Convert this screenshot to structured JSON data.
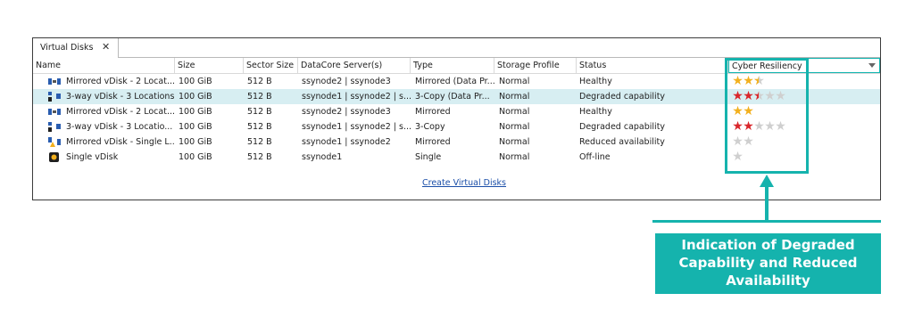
{
  "tab": {
    "label": "Virtual Disks",
    "close_glyph": "✕"
  },
  "columns": [
    {
      "key": "name",
      "label": "Name"
    },
    {
      "key": "size",
      "label": "Size"
    },
    {
      "key": "sector",
      "label": "Sector Size"
    },
    {
      "key": "servers",
      "label": "DataCore Server(s)"
    },
    {
      "key": "type",
      "label": "Type"
    },
    {
      "key": "profile",
      "label": "Storage Profile"
    },
    {
      "key": "status",
      "label": "Status"
    },
    {
      "key": "cyber",
      "label": "Cyber Resiliency"
    }
  ],
  "rows": [
    {
      "icon": "mirrored-vdisk-icon",
      "name": "Mirrored vDisk - 2 Locat...",
      "size": "100 GiB",
      "sector": "512 B",
      "servers": "ssynode2 | ssynode3",
      "type": "Mirrored (Data Pr...",
      "profile": "Normal",
      "status": "Healthy",
      "stars": [
        "gold",
        "gold",
        "half-gold"
      ],
      "selected": false
    },
    {
      "icon": "3way-vdisk-icon",
      "name": "3-way vDisk - 3 Locations",
      "size": "100 GiB",
      "sector": "512 B",
      "servers": "ssynode1 | ssynode2 | s...",
      "type": "3-Copy (Data Pr...",
      "profile": "Normal",
      "status": "Degraded capability",
      "stars": [
        "red",
        "red",
        "half-red",
        "empty",
        "empty"
      ],
      "selected": true
    },
    {
      "icon": "mirrored-vdisk-icon",
      "name": "Mirrored vDisk - 2 Locat...",
      "size": "100 GiB",
      "sector": "512 B",
      "servers": "ssynode2 | ssynode3",
      "type": "Mirrored",
      "profile": "Normal",
      "status": "Healthy",
      "stars": [
        "gold",
        "gold"
      ],
      "selected": false
    },
    {
      "icon": "3way-vdisk-icon",
      "name": "3-way vDisk - 3 Locatio...",
      "size": "100 GiB",
      "sector": "512 B",
      "servers": "ssynode1 | ssynode2 | s...",
      "type": "3-Copy",
      "profile": "Normal",
      "status": "Degraded capability",
      "stars": [
        "red",
        "red",
        "empty",
        "empty",
        "empty"
      ],
      "selected": false
    },
    {
      "icon": "mirrored-vdisk-warning-icon",
      "name": "Mirrored vDisk - Single L...",
      "size": "100 GiB",
      "sector": "512 B",
      "servers": "ssynode1 | ssynode2",
      "type": "Mirrored",
      "profile": "Normal",
      "status": "Reduced availability",
      "stars": [
        "empty",
        "empty"
      ],
      "selected": false
    },
    {
      "icon": "single-vdisk-icon",
      "name": "Single vDisk",
      "size": "100 GiB",
      "sector": "512 B",
      "servers": "ssynode1",
      "type": "Single",
      "profile": "Normal",
      "status": "Off-line",
      "stars": [
        "empty"
      ],
      "selected": false
    }
  ],
  "create_link": "Create Virtual Disks",
  "callout": {
    "lines": [
      "Indication of Degraded",
      "Capability and Reduced",
      "Availability"
    ]
  },
  "colors": {
    "accent": "#15b3ad",
    "gold_star": "#f2b01e",
    "red_star": "#d9262b",
    "empty_star": "#cfcfcf",
    "selected_row": "#d7eef2"
  }
}
